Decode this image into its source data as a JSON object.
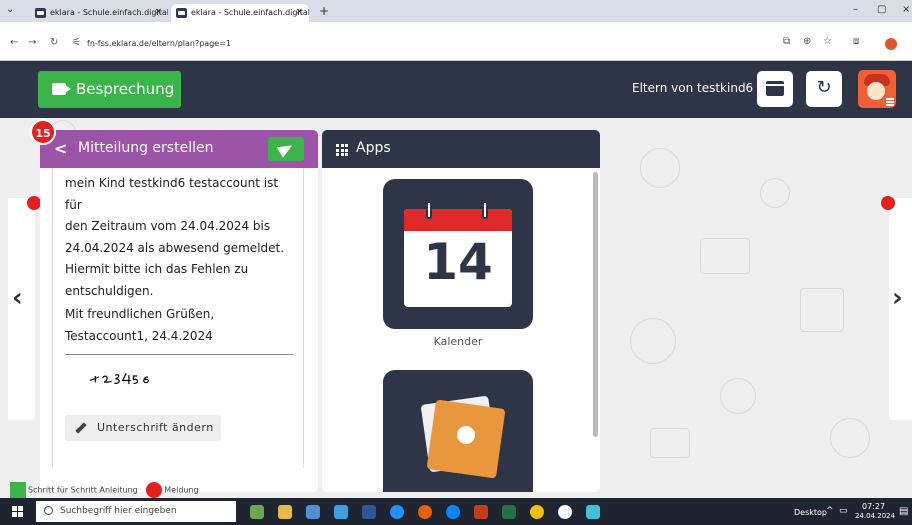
{
  "browser": {
    "tabs": [
      {
        "label": "eklara - Schule.einfach.digital.",
        "close": "×"
      },
      {
        "label": "eklara - Schule.einfach.digital.",
        "close": "×"
      }
    ],
    "new_tab": "+",
    "url": "fn-fss.eklara.de/eltern/plan?page=1",
    "window_controls": [
      "–",
      "▢",
      "×"
    ]
  },
  "header": {
    "besprechung_label": "Besprechung",
    "user_label": "Eltern von testkind6"
  },
  "badge_count": "15",
  "message_card": {
    "title": "Mitteilung erstellen",
    "body_lines": [
      "mein Kind testkind6 testaccount ist für",
      "den Zeitraum vom 24.04.2024 bis",
      "24.04.2024 als abwesend gemeldet.",
      "Hiermit bitte ich das Fehlen zu",
      "entschuldigen."
    ],
    "closing_lines": [
      "Mit freundlichen Grüßen,",
      "Testaccount1, 24.4.2024"
    ],
    "signature_text": "123456",
    "change_signature_label": "Unterschrift ändern"
  },
  "apps_card": {
    "title": "Apps",
    "calendar_day": "14",
    "calendar_label": "Kalender"
  },
  "legend": {
    "green_label": "Schritt für Schritt Anleitung",
    "red_label": "Meldung"
  },
  "taskbar": {
    "search_placeholder": "Suchbegriff hier eingeben",
    "desktop_label": "Desktop",
    "time": "07:27",
    "date": "24.04.2024"
  },
  "colors": {
    "header_bg": "#2e3547",
    "accent_green": "#3bb44a",
    "message_purple": "#9b54a8",
    "alert_red": "#e61e1e",
    "calendar_red": "#e02a2a",
    "note_orange": "#e9973c"
  }
}
